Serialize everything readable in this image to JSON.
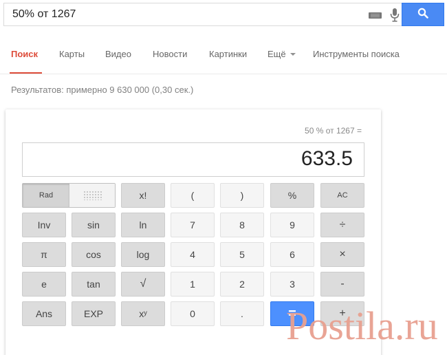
{
  "search": {
    "query": "50% от 1267",
    "keyboard_icon": "keyboard-icon",
    "mic_icon": "microphone-icon",
    "search_icon": "search-icon",
    "accent": "#4a8af4"
  },
  "tabs": {
    "items": [
      {
        "label": "Поиск",
        "active": true
      },
      {
        "label": "Карты"
      },
      {
        "label": "Видео"
      },
      {
        "label": "Новости"
      },
      {
        "label": "Картинки"
      },
      {
        "label": "Ещё"
      },
      {
        "label": "Инструменты поиска"
      }
    ],
    "active_color": "#dd4b39"
  },
  "results": {
    "stats": "Результатов: примерно 9 630 000 (0,30 сек.)"
  },
  "calculator": {
    "expression": "50 % от 1267 =",
    "result": "633.5",
    "rad_label": "Rad",
    "buttons": {
      "fact": "x!",
      "lparen": "(",
      "rparen": ")",
      "percent": "%",
      "ac": "AC",
      "inv": "Inv",
      "sin": "sin",
      "ln": "ln",
      "n7": "7",
      "n8": "8",
      "n9": "9",
      "div": "÷",
      "pi": "π",
      "cos": "cos",
      "log": "log",
      "n4": "4",
      "n5": "5",
      "n6": "6",
      "mul": "×",
      "e": "e",
      "tan": "tan",
      "sqrt": "√",
      "n1": "1",
      "n2": "2",
      "n3": "3",
      "sub": "-",
      "ans": "Ans",
      "exp": "EXP",
      "pow": "xʸ",
      "n0": "0",
      "dot": ".",
      "eq": "=",
      "add": "+"
    },
    "equals_color": "#4d90fe"
  },
  "watermark": {
    "text": "Postila.ru"
  }
}
